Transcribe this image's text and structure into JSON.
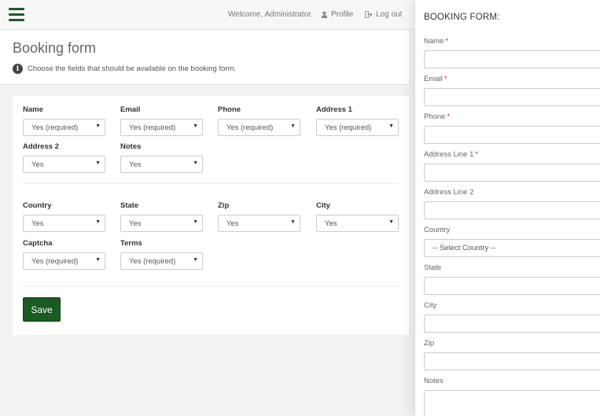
{
  "topbar": {
    "welcome": "Welcome, Administrator.",
    "profile": "Profile",
    "logout": "Log out",
    "menu_icon": "hamburger-icon",
    "accent": "#1d5a2b"
  },
  "header": {
    "title": "Booking form",
    "info": "Choose the fields that should be available on the booking form."
  },
  "form": {
    "fields": [
      {
        "label": "Name",
        "value": "Yes (required)"
      },
      {
        "label": "Email",
        "value": "Yes (required)"
      },
      {
        "label": "Phone",
        "value": "Yes (required)"
      },
      {
        "label": "Address 1",
        "value": "Yes (required)"
      },
      {
        "label": "Address 2",
        "value": "Yes"
      },
      {
        "label": "Notes",
        "value": "Yes"
      },
      {
        "label": "Country",
        "value": "Yes"
      },
      {
        "label": "State",
        "value": "Yes"
      },
      {
        "label": "Zip",
        "value": "Yes"
      },
      {
        "label": "City",
        "value": "Yes"
      },
      {
        "label": "Captcha",
        "value": "Yes (required)"
      },
      {
        "label": "Terms",
        "value": "Yes (required)"
      }
    ],
    "save_label": "Save",
    "save_color": "#1a5a23"
  },
  "preview": {
    "title": "BOOKING FORM:",
    "fields": [
      {
        "label": "Name",
        "required": "*"
      },
      {
        "label": "Email",
        "required": "*"
      },
      {
        "label": "Phone",
        "required": "*"
      },
      {
        "label": "Address Line 1",
        "required": "*"
      },
      {
        "label": "Address Line 2"
      },
      {
        "label": "Country",
        "value": "-- Select Country --"
      },
      {
        "label": "State"
      },
      {
        "label": "City"
      },
      {
        "label": "Zip"
      },
      {
        "label": "Notes"
      }
    ]
  }
}
